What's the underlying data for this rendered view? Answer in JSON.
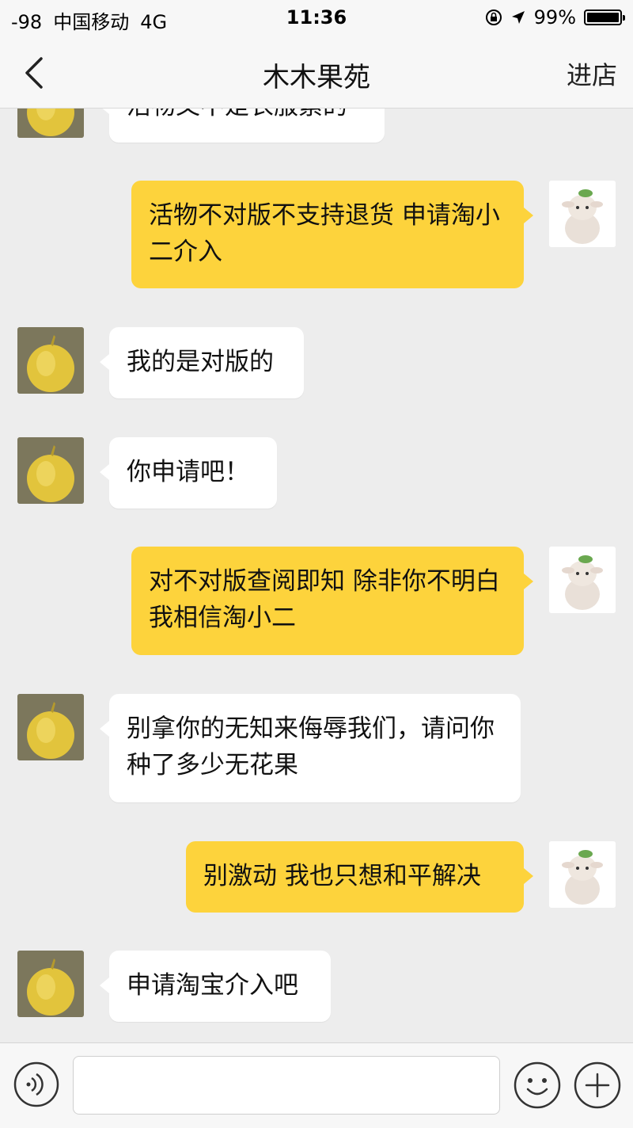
{
  "status_bar": {
    "signal": "-98",
    "carrier": "中国移动",
    "network": "4G",
    "time": "11:36",
    "battery": "99%",
    "battery_level": 0.99
  },
  "nav": {
    "back_icon": "chevron-left-icon",
    "title": "木木果苑",
    "right_action": "进店"
  },
  "messages": [
    {
      "from": "shop",
      "text": "活物又不是衣服素的"
    },
    {
      "from": "me",
      "text": "活物不对版不支持退货 申请淘小二介入"
    },
    {
      "from": "shop",
      "text": "我的是对版的"
    },
    {
      "from": "shop",
      "text": "你申请吧！"
    },
    {
      "from": "me",
      "text": "对不对版查阅即知 除非你不明白 我相信淘小二"
    },
    {
      "from": "shop",
      "text": "别拿你的无知来侮辱我们，请问你种了多少无花果"
    },
    {
      "from": "me",
      "text": "别激动 我也只想和平解决"
    },
    {
      "from": "shop",
      "text": "申请淘宝介入吧"
    }
  ],
  "input_bar": {
    "voice_icon": "voice-icon",
    "emoji_icon": "emoji-icon",
    "plus_icon": "plus-icon",
    "placeholder": ""
  },
  "colors": {
    "background": "#ededed",
    "incoming_bubble": "#ffffff",
    "outgoing_bubble": "#fdd33c",
    "bar": "#f7f7f7"
  }
}
